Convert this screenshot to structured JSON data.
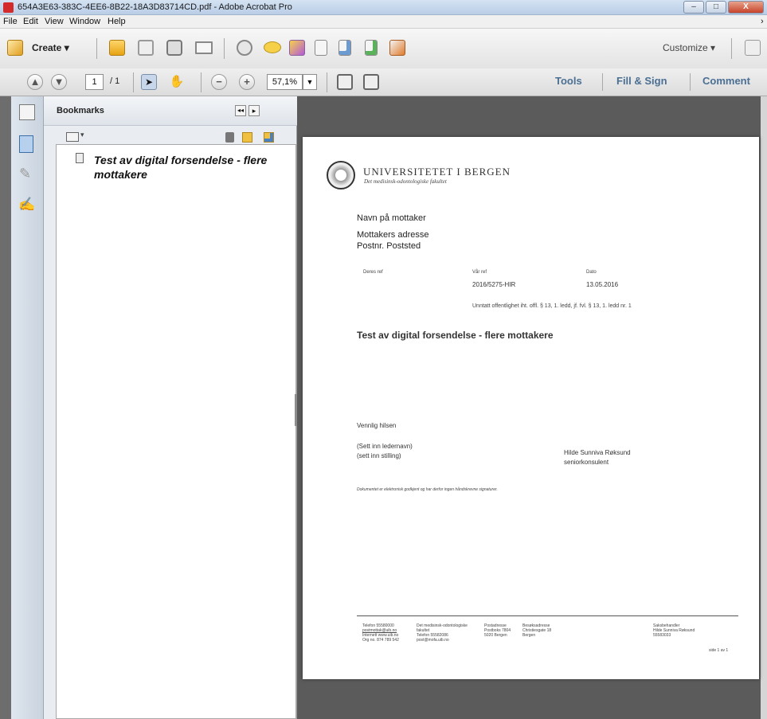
{
  "window": {
    "title": "654A3E63-383C-4EE6-8B22-18A3D83714CD.pdf - Adobe Acrobat Pro",
    "min_label": "–",
    "max_label": "□",
    "close_label": "X"
  },
  "menu": [
    "File",
    "Edit",
    "View",
    "Window",
    "Help"
  ],
  "toolbar": {
    "create_label": "Create",
    "customize_label": "Customize",
    "dropdown_glyph": "▾"
  },
  "nav": {
    "page_value": "1",
    "page_total": "/ 1",
    "zoom_value": "57,1%",
    "tabs": [
      "Tools",
      "Fill & Sign",
      "Comment"
    ]
  },
  "bookmarks": {
    "title": "Bookmarks",
    "collapse_glyph": "◂◂",
    "expand_glyph": "▸",
    "options_glyph": "▾",
    "items": [
      "Test av digital forsendelse - flere mottakere"
    ]
  },
  "document": {
    "university": "UNIVERSITETET I BERGEN",
    "faculty": "Det medisinsk-odontologiske fakultet",
    "recipient_name": "Navn på mottaker",
    "recipient_address": "Mottakers adresse",
    "recipient_postal": "Postnr. Poststed",
    "ref_labels": [
      "Deres ref",
      "Vår ref",
      "Dato"
    ],
    "our_ref": "2016/5275-HIR",
    "date": "13.05.2016",
    "exemption": "Unntatt offentlighet iht. offl. § 13, 1. ledd, jf. fvl. § 13, 1. ledd nr. 1",
    "subject": "Test av digital forsendelse - flere mottakere",
    "greeting": "Vennlig hilsen",
    "leader_name": "(Sett inn ledernavn)",
    "leader_title": "(sett inn stilling)",
    "sender_name": "Hilde Sunniva Røksund",
    "sender_title": "seniorkonsulent",
    "electronic_note": "Dokumentet er elektronisk godkjent og har derfor ingen håndskrevne signaturer.",
    "footer": {
      "col1": [
        "Telefon 55580000",
        "postmottak@uib.no",
        "Internett www.uib.no",
        "Org no. 874 789 542"
      ],
      "col2": [
        "Det medisinsk-odontologiske",
        "fakultet",
        "Telefon 55582086",
        "post@mofa.uib.no"
      ],
      "col3": [
        "Postadresse",
        "Postboks 7804",
        "5020 Bergen"
      ],
      "col4": [
        "Besøksadresse",
        "Christiesgate 18",
        "Bergen"
      ],
      "col5": [
        "Saksbehandler",
        "Hilde Sunniva Røksund",
        "55583033"
      ]
    },
    "page_label": "side 1 av 1"
  },
  "colors": {
    "accent_blue": "#4a6f93",
    "acrobat_red": "#d32b2b"
  }
}
